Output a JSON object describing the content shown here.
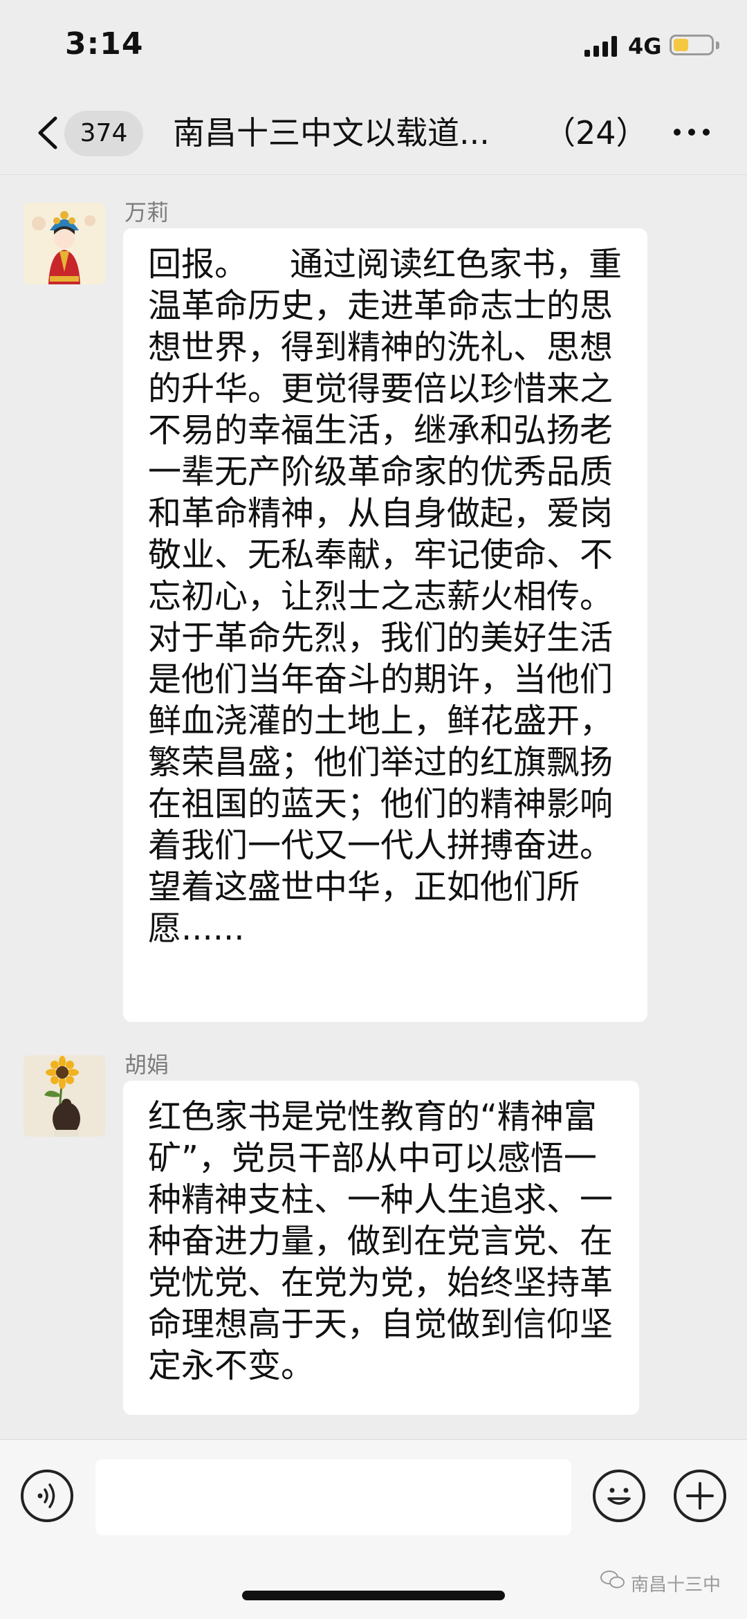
{
  "status_bar": {
    "time": "3:14",
    "network": "4G",
    "battery_level": 0.4,
    "battery_color": "#f5c842"
  },
  "nav": {
    "back_icon": "chevron-left-icon",
    "unread_count": "374",
    "title": "南昌十三中文以载道...",
    "member_count": "（24）",
    "more_icon": "ellipsis-icon"
  },
  "messages": [
    {
      "sender": "万莉",
      "avatar": "avatar-costume-lady",
      "text": "回报。    通过阅读红色家书，重温革命历史，走进革命志士的思想世界，得到精神的洗礼、思想的升华。更觉得要倍以珍惜来之不易的幸福生活，继承和弘扬老一辈无产阶级革命家的优秀品质和革命精神，从自身做起，爱岗敬业、无私奉献，牢记使命、不忘初心，让烈士之志薪火相传。对于革命先烈，我们的美好生活是他们当年奋斗的期许，当他们鲜血浇灌的土地上，鲜花盛开，繁荣昌盛；他们举过的红旗飘扬在祖国的蓝天；他们的精神影响着我们一代又一代人拼搏奋进。望着这盛世中华，正如他们所愿......"
    },
    {
      "sender": "胡娟",
      "avatar": "avatar-sunflower-girl",
      "text": "红色家书是党性教育的“精神富矿”，党员干部从中可以感悟一种精神支柱、一种人生追求、一种奋进力量，做到在党言党、在党忧党、在党为党，始终坚持革命理想高于天，自觉做到信仰坚定永不变。"
    }
  ],
  "input_bar": {
    "voice_icon": "voice-icon",
    "input_value": "",
    "emoji_icon": "smiley-icon",
    "plus_icon": "plus-icon"
  },
  "watermark": {
    "icon": "wechat-icon",
    "text": "南昌十三中"
  },
  "colors": {
    "background": "#ededed",
    "bubble": "#ffffff",
    "input_bar": "#f6f6f6",
    "name_text": "#7d7d7d"
  }
}
